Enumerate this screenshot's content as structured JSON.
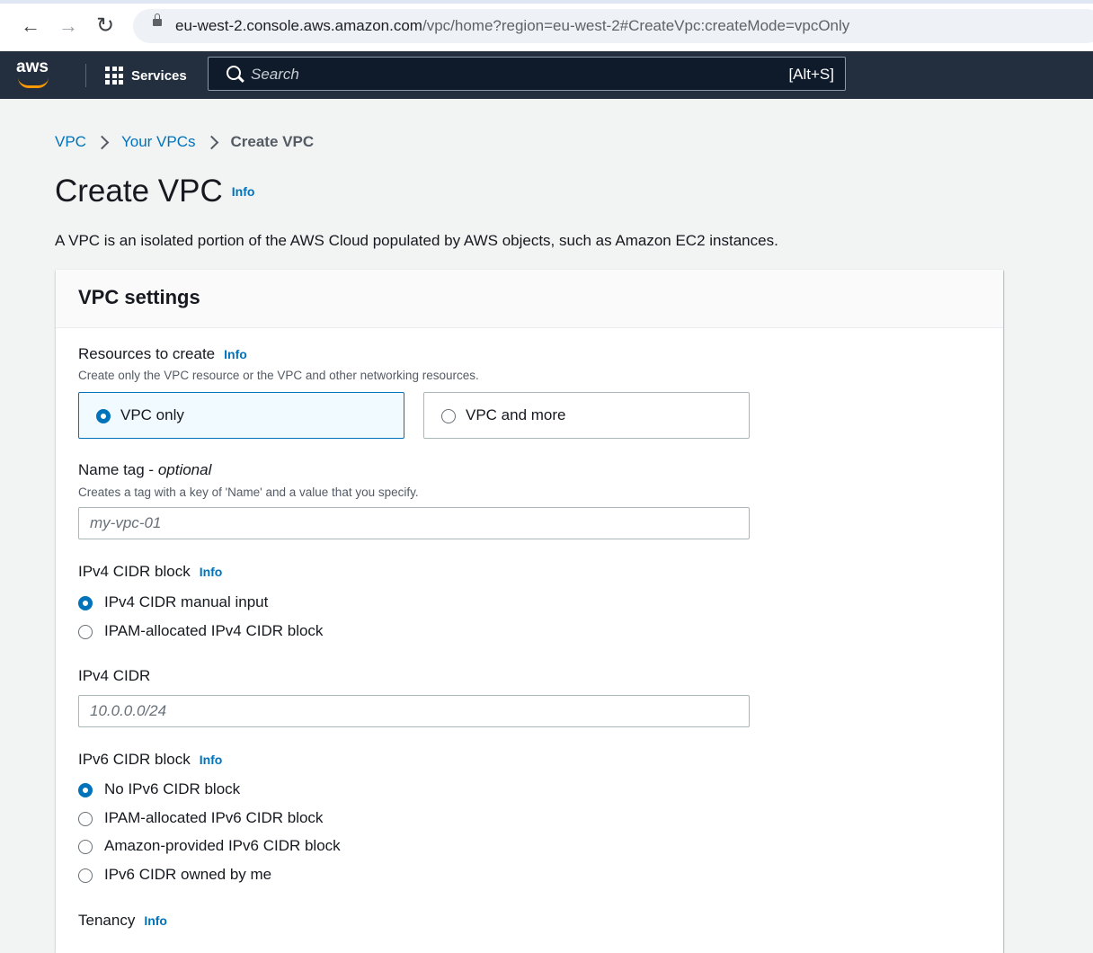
{
  "browser": {
    "url_host": "eu-west-2.console.aws.amazon.com",
    "url_path": "/vpc/home?region=eu-west-2#CreateVpc:createMode=vpcOnly"
  },
  "aws_nav": {
    "logo_text": "aws",
    "services_label": "Services",
    "search_placeholder": "Search",
    "search_shortcut": "[Alt+S]"
  },
  "breadcrumb": [
    "VPC",
    "Your VPCs",
    "Create VPC"
  ],
  "page": {
    "title": "Create VPC",
    "title_info": "Info",
    "description": "A VPC is an isolated portion of the AWS Cloud populated by AWS objects, such as Amazon EC2 instances."
  },
  "vpc_settings": {
    "heading": "VPC settings",
    "resources": {
      "label": "Resources to create",
      "info": "Info",
      "description": "Create only the VPC resource or the VPC and other networking resources.",
      "options": [
        {
          "label": "VPC only",
          "selected": true
        },
        {
          "label": "VPC and more",
          "selected": false
        }
      ]
    },
    "name_tag": {
      "label": "Name tag - ",
      "label_optional": "optional",
      "description": "Creates a tag with a key of 'Name' and a value that you specify.",
      "placeholder": "my-vpc-01"
    },
    "ipv4_block": {
      "label": "IPv4 CIDR block",
      "info": "Info",
      "options": [
        {
          "label": "IPv4 CIDR manual input",
          "selected": true
        },
        {
          "label": "IPAM-allocated IPv4 CIDR block",
          "selected": false
        }
      ]
    },
    "ipv4_cidr": {
      "label": "IPv4 CIDR",
      "placeholder": "10.0.0.0/24"
    },
    "ipv6_block": {
      "label": "IPv6 CIDR block",
      "info": "Info",
      "options": [
        {
          "label": "No IPv6 CIDR block",
          "selected": true
        },
        {
          "label": "IPAM-allocated IPv6 CIDR block",
          "selected": false
        },
        {
          "label": "Amazon-provided IPv6 CIDR block",
          "selected": false
        },
        {
          "label": "IPv6 CIDR owned by me",
          "selected": false
        }
      ]
    },
    "tenancy": {
      "label": "Tenancy",
      "info": "Info"
    }
  },
  "colors": {
    "aws_nav_bg": "#232f3e",
    "link_blue": "#0073bb",
    "aws_orange": "#ff9900"
  }
}
